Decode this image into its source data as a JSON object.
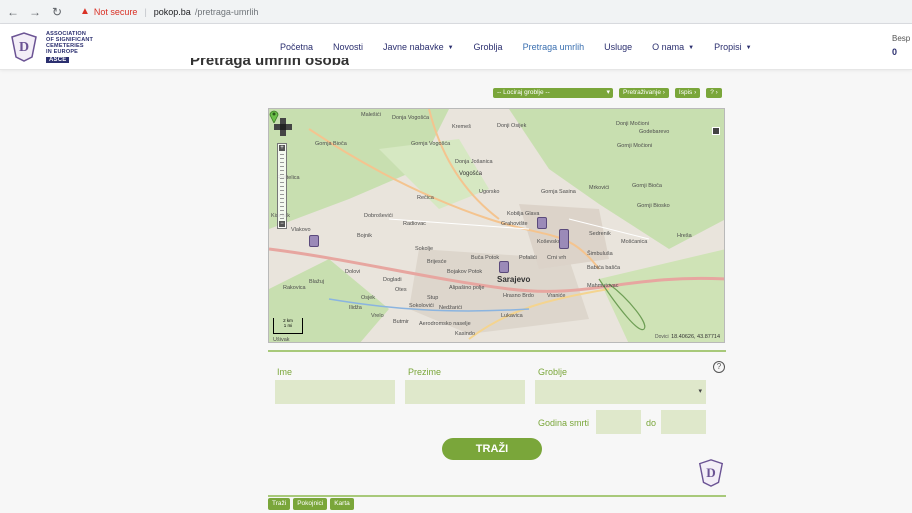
{
  "browser": {
    "security_label": "Not secure",
    "domain": "pokop.ba",
    "path": "/pretraga-umrlih"
  },
  "header": {
    "logo_line1": "ASSOCIATION",
    "logo_line2": "OF SIGNIFICANT",
    "logo_line3": "CEMETERIES",
    "logo_line4": "IN EUROPE",
    "logo_abbr": "ASCE",
    "menu": [
      {
        "label": "Početna",
        "dropdown": false,
        "active": false
      },
      {
        "label": "Novosti",
        "dropdown": false,
        "active": false
      },
      {
        "label": "Javne nabavke",
        "dropdown": true,
        "active": false
      },
      {
        "label": "Groblja",
        "dropdown": false,
        "active": false
      },
      {
        "label": "Pretraga umrlih",
        "dropdown": false,
        "active": true
      },
      {
        "label": "Usluge",
        "dropdown": false,
        "active": false
      },
      {
        "label": "O nama",
        "dropdown": true,
        "active": false
      },
      {
        "label": "Propisi",
        "dropdown": true,
        "active": false
      }
    ],
    "right_text": "Besp",
    "right_number": "0"
  },
  "page_title": "Pretraga umrlih osoba",
  "toolbar": {
    "cemetery_select": "-- Lociraj groblje --",
    "search_btn": "Pretraživanje ›",
    "print_btn": "Ispis ›",
    "help_btn": "? ›"
  },
  "map": {
    "city": "Sarajevo",
    "coords": "18.40626, 43.87714",
    "attribution": "Dovici",
    "scale_top": "2 km",
    "scale_bottom": "1 mi",
    "labels": [
      "Malešići",
      "Donja Vogošća",
      "Donji Močioni",
      "Gornja Bioča",
      "Kremeš",
      "Vogošća",
      "Donja Jošanica",
      "Gornja Vogošća",
      "Gornji Močioni",
      "Gornji Bioča",
      "Godebarevo",
      "Ugorsko",
      "Gornja Sasina",
      "Mrkovići",
      "Gornji Biosko",
      "Kobilja Glava",
      "Rečica",
      "Dobroševići",
      "Radiovac",
      "Koševsko",
      "Sedrenik",
      "Mošćanica",
      "Hreša",
      "Vlakovo",
      "Bojnik",
      "Sokolje",
      "Grahovište",
      "Buča Potok",
      "Pofalići",
      "Šimbuluša",
      "Dolovi",
      "Brijesće",
      "Bojakov Potok",
      "Crni vrh",
      "Babića bašča",
      "Dogladi",
      "Otes",
      "Stup",
      "Alipašino polje",
      "Hrasno Brdo",
      "Vraniće",
      "Mahmutovac",
      "Rakovica",
      "Osjek",
      "Ilidža",
      "Nedžarići",
      "Lukavica",
      "Vrelo",
      "Sokolovići",
      "Aerodromsko naselje",
      "Kasindo",
      "Butmir",
      "Blažuj",
      "Ušivak",
      "Kiseljak",
      "Raštelica",
      "Donji Osijek"
    ]
  },
  "form": {
    "first_name_label": "Ime",
    "last_name_label": "Prezime",
    "cemetery_label": "Groblje",
    "death_year_label": "Godina smrti",
    "to_label": "do",
    "search_button": "TRAŽI"
  },
  "bottom_tabs": [
    "Traži",
    "Pokojnici",
    "Karta"
  ]
}
